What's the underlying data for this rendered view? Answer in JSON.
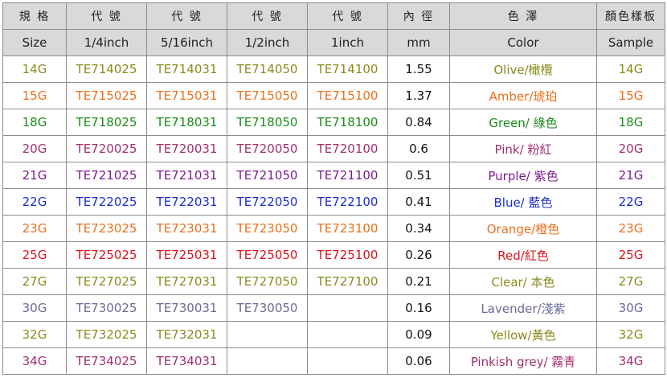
{
  "headers_cn": [
    "規 格",
    "代 號",
    "代 號",
    "代 號",
    "代 號",
    "內 徑",
    "色 澤",
    "顏色樣板"
  ],
  "headers_en": [
    "Size",
    "1/4inch",
    "5/16inch",
    "1/2inch",
    "1inch",
    "mm",
    "Color",
    "Sample"
  ],
  "rows": [
    {
      "size": "14G",
      "c1": "TE714025",
      "c2": "TE714031",
      "c3": "TE714050",
      "c4": "TE714100",
      "mm": "1.55",
      "color": "Olive/橄欖",
      "sample": "14G",
      "hex": "#8a8a1e"
    },
    {
      "size": "15G",
      "c1": "TE715025",
      "c2": "TE715031",
      "c3": "TE715050",
      "c4": "TE715100",
      "mm": "1.37",
      "color": "Amber/琥珀",
      "sample": "15G",
      "hex": "#e8701c"
    },
    {
      "size": "18G",
      "c1": "TE718025",
      "c2": "TE718031",
      "c3": "TE718050",
      "c4": "TE718100",
      "mm": "0.84",
      "color": "Green/ 綠色",
      "sample": "18G",
      "hex": "#1a8a1a"
    },
    {
      "size": "20G",
      "c1": "TE720025",
      "c2": "TE720031",
      "c3": "TE720050",
      "c4": "TE720100",
      "mm": "0.6",
      "color": "Pink/ 粉紅",
      "sample": "20G",
      "hex": "#a0306e"
    },
    {
      "size": "21G",
      "c1": "TE721025",
      "c2": "TE721031",
      "c3": "TE721050",
      "c4": "TE721100",
      "mm": "0.51",
      "color": "Purple/ 紫色",
      "sample": "21G",
      "hex": "#7a1e8c"
    },
    {
      "size": "22G",
      "c1": "TE722025",
      "c2": "TE722031",
      "c3": "TE722050",
      "c4": "TE722100",
      "mm": "0.41",
      "color": "Blue/ 藍色",
      "sample": "22G",
      "hex": "#1c2ec8"
    },
    {
      "size": "23G",
      "c1": "TE723025",
      "c2": "TE723031",
      "c3": "TE723050",
      "c4": "TE723100",
      "mm": "0.34",
      "color": "Orange/橙色",
      "sample": "23G",
      "hex": "#e8701c"
    },
    {
      "size": "25G",
      "c1": "TE725025",
      "c2": "TE725031",
      "c3": "TE725050",
      "c4": "TE725100",
      "mm": "0.26",
      "color": "Red/紅色",
      "sample": "25G",
      "hex": "#d4141c"
    },
    {
      "size": "27G",
      "c1": "TE727025",
      "c2": "TE727031",
      "c3": "TE727050",
      "c4": "TE727100",
      "mm": "0.21",
      "color": "Clear/ 本色",
      "sample": "27G",
      "hex": "#8a8a1e"
    },
    {
      "size": "30G",
      "c1": "TE730025",
      "c2": "TE730031",
      "c3": "TE730050",
      "c4": "",
      "mm": "0.16",
      "color": "Lavender/淺紫",
      "sample": "30G",
      "hex": "#6a6a96"
    },
    {
      "size": "32G",
      "c1": "TE732025",
      "c2": "TE732031",
      "c3": "",
      "c4": "",
      "mm": "0.09",
      "color": "Yellow/黃色",
      "sample": "32G",
      "hex": "#8a8a1e"
    },
    {
      "size": "34G",
      "c1": "TE734025",
      "c2": "TE734031",
      "c3": "",
      "c4": "",
      "mm": "0.06",
      "color": "Pinkish grey/ 霧青",
      "sample": "34G",
      "hex": "#a0306e"
    }
  ]
}
